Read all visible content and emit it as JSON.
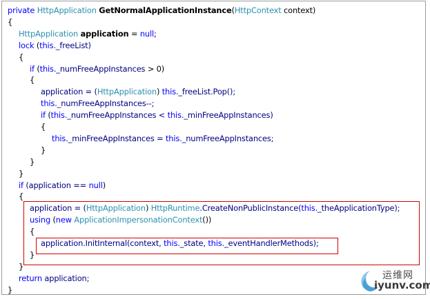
{
  "lines": [
    {
      "indent": 8,
      "parts": [
        {
          "t": "private ",
          "c": "kw"
        },
        {
          "t": "HttpApplication ",
          "c": "ty"
        },
        {
          "t": "GetNormalApplicationInstance",
          "c": "b"
        },
        {
          "t": "(",
          "c": ""
        },
        {
          "t": "HttpContext",
          "c": "ty"
        },
        {
          "t": " context)",
          "c": ""
        }
      ]
    },
    {
      "indent": 8,
      "parts": [
        {
          "t": "{",
          "c": ""
        }
      ]
    },
    {
      "indent": 24,
      "parts": [
        {
          "t": "HttpApplication ",
          "c": "ty"
        },
        {
          "t": "application",
          "c": "b"
        },
        {
          "t": " = ",
          "c": ""
        },
        {
          "t": "null",
          "c": "kw"
        },
        {
          "t": ";",
          "c": ""
        }
      ]
    },
    {
      "indent": 24,
      "parts": [
        {
          "t": "lock",
          "c": "kw"
        },
        {
          "t": " (",
          "c": ""
        },
        {
          "t": "this",
          "c": "kw"
        },
        {
          "t": "._freeList)",
          "c": "id"
        }
      ]
    },
    {
      "indent": 24,
      "parts": [
        {
          "t": "{",
          "c": ""
        }
      ]
    },
    {
      "indent": 40,
      "parts": [
        {
          "t": "if",
          "c": "kw"
        },
        {
          "t": " (",
          "c": ""
        },
        {
          "t": "this",
          "c": "kw"
        },
        {
          "t": "._numFreeAppInstances",
          "c": "id"
        },
        {
          "t": " > 0)",
          "c": ""
        }
      ]
    },
    {
      "indent": 40,
      "parts": [
        {
          "t": "{",
          "c": ""
        }
      ]
    },
    {
      "indent": 56,
      "parts": [
        {
          "t": "application = (",
          "c": "id"
        },
        {
          "t": "HttpApplication",
          "c": "ty"
        },
        {
          "t": ") ",
          "c": ""
        },
        {
          "t": "this",
          "c": "kw"
        },
        {
          "t": "._freeList.Pop();",
          "c": "id"
        }
      ]
    },
    {
      "indent": 56,
      "parts": [
        {
          "t": "this",
          "c": "kw"
        },
        {
          "t": "._numFreeAppInstances--;",
          "c": "id"
        }
      ]
    },
    {
      "indent": 56,
      "parts": [
        {
          "t": "if",
          "c": "kw"
        },
        {
          "t": " (",
          "c": ""
        },
        {
          "t": "this",
          "c": "kw"
        },
        {
          "t": "._numFreeAppInstances < ",
          "c": "id"
        },
        {
          "t": "this",
          "c": "kw"
        },
        {
          "t": "._minFreeAppInstances)",
          "c": "id"
        }
      ]
    },
    {
      "indent": 56,
      "parts": [
        {
          "t": "{",
          "c": ""
        }
      ]
    },
    {
      "indent": 72,
      "parts": [
        {
          "t": "this",
          "c": "kw"
        },
        {
          "t": "._minFreeAppInstances = ",
          "c": "id"
        },
        {
          "t": "this",
          "c": "kw"
        },
        {
          "t": "._numFreeAppInstances;",
          "c": "id"
        }
      ]
    },
    {
      "indent": 56,
      "parts": [
        {
          "t": "}",
          "c": ""
        }
      ]
    },
    {
      "indent": 40,
      "parts": [
        {
          "t": "}",
          "c": ""
        }
      ]
    },
    {
      "indent": 24,
      "parts": [
        {
          "t": "}",
          "c": ""
        }
      ]
    },
    {
      "indent": 24,
      "parts": [
        {
          "t": "if",
          "c": "kw"
        },
        {
          "t": " (application == ",
          "c": "id"
        },
        {
          "t": "null",
          "c": "kw"
        },
        {
          "t": ")",
          "c": ""
        }
      ]
    },
    {
      "indent": 24,
      "parts": [
        {
          "t": "{",
          "c": ""
        }
      ]
    },
    {
      "indent": 40,
      "parts": [
        {
          "t": "application = (",
          "c": "id"
        },
        {
          "t": "HttpApplication",
          "c": "ty"
        },
        {
          "t": ") ",
          "c": ""
        },
        {
          "t": "HttpRuntime",
          "c": "ty"
        },
        {
          "t": ".CreateNonPublicInstance(",
          "c": "id"
        },
        {
          "t": "this",
          "c": "kw"
        },
        {
          "t": "._theApplicationType);",
          "c": "id"
        }
      ]
    },
    {
      "indent": 40,
      "parts": [
        {
          "t": "using",
          "c": "kw"
        },
        {
          "t": " (",
          "c": ""
        },
        {
          "t": "new ",
          "c": "kw"
        },
        {
          "t": "ApplicationImpersonationContext",
          "c": "ty"
        },
        {
          "t": "())",
          "c": ""
        }
      ]
    },
    {
      "indent": 40,
      "parts": [
        {
          "t": "{",
          "c": ""
        }
      ]
    },
    {
      "indent": 56,
      "parts": [
        {
          "t": "application.InitInternal(context, ",
          "c": "id"
        },
        {
          "t": "this",
          "c": "kw"
        },
        {
          "t": "._state, ",
          "c": "id"
        },
        {
          "t": "this",
          "c": "kw"
        },
        {
          "t": "._eventHandlerMethods);",
          "c": "id"
        }
      ]
    },
    {
      "indent": 40,
      "parts": [
        {
          "t": "}",
          "c": ""
        }
      ]
    },
    {
      "indent": 24,
      "parts": [
        {
          "t": "}",
          "c": ""
        }
      ]
    },
    {
      "indent": 24,
      "parts": [
        {
          "t": "return",
          "c": "kw"
        },
        {
          "t": " application;",
          "c": "id"
        }
      ]
    },
    {
      "indent": 8,
      "parts": [
        {
          "t": "}",
          "c": ""
        }
      ]
    }
  ],
  "watermark": {
    "brand_cn": "运维网",
    "brand_url": "iyunv.com"
  }
}
